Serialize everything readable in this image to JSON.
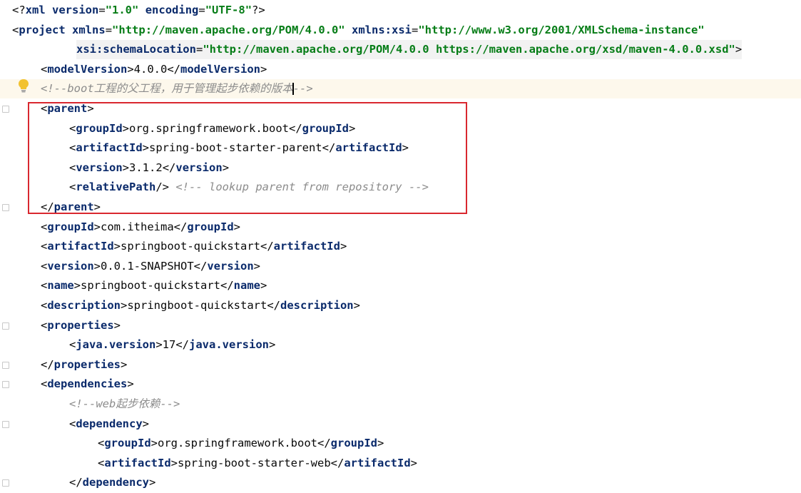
{
  "editor": {
    "lines": [
      {
        "indent": 0,
        "parts": [
          [
            "decl",
            "<?"
          ],
          [
            "tag",
            "xml"
          ],
          [
            "text",
            " "
          ],
          [
            "attr",
            "version"
          ],
          [
            "punc",
            "="
          ],
          [
            "str",
            "\"1.0\""
          ],
          [
            "text",
            " "
          ],
          [
            "attr",
            "encoding"
          ],
          [
            "punc",
            "="
          ],
          [
            "str",
            "\"UTF-8\""
          ],
          [
            "decl",
            "?>"
          ]
        ]
      },
      {
        "indent": 0,
        "parts": [
          [
            "punc",
            "<"
          ],
          [
            "tag",
            "project"
          ],
          [
            "text",
            " "
          ],
          [
            "attr",
            "xmlns"
          ],
          [
            "punc",
            "="
          ],
          [
            "str",
            "\"http://maven.apache.org/POM/4.0.0\""
          ],
          [
            "text",
            " "
          ],
          [
            "attr",
            "xmlns:xsi"
          ],
          [
            "punc",
            "="
          ],
          [
            "str",
            "\"http://www.w3.org/2001/XMLSchema-instance\""
          ]
        ]
      },
      {
        "indent": 2.25,
        "schema": true,
        "parts": [
          [
            "attr",
            "xsi:schemaLocation"
          ],
          [
            "punc",
            "="
          ],
          [
            "str",
            "\"http://maven.apache.org/POM/4.0.0 https://maven.apache.org/xsd/maven-4.0.0.xsd\""
          ],
          [
            "punc",
            ">"
          ]
        ]
      },
      {
        "indent": 1,
        "parts": [
          [
            "punc",
            "<"
          ],
          [
            "tag",
            "modelVersion"
          ],
          [
            "punc",
            ">"
          ],
          [
            "text",
            "4.0.0"
          ],
          [
            "punc",
            "</"
          ],
          [
            "tag",
            "modelVersion"
          ],
          [
            "punc",
            ">"
          ]
        ]
      },
      {
        "indent": 1,
        "hl": true,
        "parts": [
          [
            "comment",
            "<!--boot工程的父工程，用于管理起步依赖的版本"
          ],
          [
            "caret",
            ""
          ],
          [
            "comment",
            "-->"
          ]
        ]
      },
      {
        "indent": 1,
        "parts": [
          [
            "punc",
            "<"
          ],
          [
            "tag",
            "parent"
          ],
          [
            "punc",
            ">"
          ]
        ]
      },
      {
        "indent": 2,
        "parts": [
          [
            "punc",
            "<"
          ],
          [
            "tag",
            "groupId"
          ],
          [
            "punc",
            ">"
          ],
          [
            "text",
            "org.springframework.boot"
          ],
          [
            "punc",
            "</"
          ],
          [
            "tag",
            "groupId"
          ],
          [
            "punc",
            ">"
          ]
        ]
      },
      {
        "indent": 2,
        "parts": [
          [
            "punc",
            "<"
          ],
          [
            "tag",
            "artifactId"
          ],
          [
            "punc",
            ">"
          ],
          [
            "text",
            "spring-boot-starter-parent"
          ],
          [
            "punc",
            "</"
          ],
          [
            "tag",
            "artifactId"
          ],
          [
            "punc",
            ">"
          ]
        ]
      },
      {
        "indent": 2,
        "parts": [
          [
            "punc",
            "<"
          ],
          [
            "tag",
            "version"
          ],
          [
            "punc",
            ">"
          ],
          [
            "text",
            "3.1.2"
          ],
          [
            "punc",
            "</"
          ],
          [
            "tag",
            "version"
          ],
          [
            "punc",
            ">"
          ]
        ]
      },
      {
        "indent": 2,
        "parts": [
          [
            "punc",
            "<"
          ],
          [
            "tag",
            "relativePath"
          ],
          [
            "punc",
            "/>"
          ],
          [
            "text",
            " "
          ],
          [
            "comment",
            "<!-- lookup parent from repository -->"
          ]
        ]
      },
      {
        "indent": 1,
        "parts": [
          [
            "punc",
            "</"
          ],
          [
            "tag",
            "parent"
          ],
          [
            "punc",
            ">"
          ]
        ]
      },
      {
        "indent": 1,
        "parts": [
          [
            "punc",
            "<"
          ],
          [
            "tag",
            "groupId"
          ],
          [
            "punc",
            ">"
          ],
          [
            "text",
            "com.itheima"
          ],
          [
            "punc",
            "</"
          ],
          [
            "tag",
            "groupId"
          ],
          [
            "punc",
            ">"
          ]
        ]
      },
      {
        "indent": 1,
        "parts": [
          [
            "punc",
            "<"
          ],
          [
            "tag",
            "artifactId"
          ],
          [
            "punc",
            ">"
          ],
          [
            "text",
            "springboot-quickstart"
          ],
          [
            "punc",
            "</"
          ],
          [
            "tag",
            "artifactId"
          ],
          [
            "punc",
            ">"
          ]
        ]
      },
      {
        "indent": 1,
        "parts": [
          [
            "punc",
            "<"
          ],
          [
            "tag",
            "version"
          ],
          [
            "punc",
            ">"
          ],
          [
            "text",
            "0.0.1-SNAPSHOT"
          ],
          [
            "punc",
            "</"
          ],
          [
            "tag",
            "version"
          ],
          [
            "punc",
            ">"
          ]
        ]
      },
      {
        "indent": 1,
        "parts": [
          [
            "punc",
            "<"
          ],
          [
            "tag",
            "name"
          ],
          [
            "punc",
            ">"
          ],
          [
            "text",
            "springboot-quickstart"
          ],
          [
            "punc",
            "</"
          ],
          [
            "tag",
            "name"
          ],
          [
            "punc",
            ">"
          ]
        ]
      },
      {
        "indent": 1,
        "parts": [
          [
            "punc",
            "<"
          ],
          [
            "tag",
            "description"
          ],
          [
            "punc",
            ">"
          ],
          [
            "text",
            "springboot-quickstart"
          ],
          [
            "punc",
            "</"
          ],
          [
            "tag",
            "description"
          ],
          [
            "punc",
            ">"
          ]
        ]
      },
      {
        "indent": 1,
        "parts": [
          [
            "punc",
            "<"
          ],
          [
            "tag",
            "properties"
          ],
          [
            "punc",
            ">"
          ]
        ]
      },
      {
        "indent": 2,
        "parts": [
          [
            "punc",
            "<"
          ],
          [
            "tag",
            "java.version"
          ],
          [
            "punc",
            ">"
          ],
          [
            "text",
            "17"
          ],
          [
            "punc",
            "</"
          ],
          [
            "tag",
            "java.version"
          ],
          [
            "punc",
            ">"
          ]
        ]
      },
      {
        "indent": 1,
        "parts": [
          [
            "punc",
            "</"
          ],
          [
            "tag",
            "properties"
          ],
          [
            "punc",
            ">"
          ]
        ]
      },
      {
        "indent": 1,
        "parts": [
          [
            "punc",
            "<"
          ],
          [
            "tag",
            "dependencies"
          ],
          [
            "punc",
            ">"
          ]
        ]
      },
      {
        "indent": 2,
        "parts": [
          [
            "comment",
            "<!--web起步依赖-->"
          ]
        ]
      },
      {
        "indent": 2,
        "parts": [
          [
            "punc",
            "<"
          ],
          [
            "tag",
            "dependency"
          ],
          [
            "punc",
            ">"
          ]
        ]
      },
      {
        "indent": 3,
        "parts": [
          [
            "punc",
            "<"
          ],
          [
            "tag",
            "groupId"
          ],
          [
            "punc",
            ">"
          ],
          [
            "text",
            "org.springframework.boot"
          ],
          [
            "punc",
            "</"
          ],
          [
            "tag",
            "groupId"
          ],
          [
            "punc",
            ">"
          ]
        ]
      },
      {
        "indent": 3,
        "parts": [
          [
            "punc",
            "<"
          ],
          [
            "tag",
            "artifactId"
          ],
          [
            "punc",
            ">"
          ],
          [
            "text",
            "spring-boot-starter-web"
          ],
          [
            "punc",
            "</"
          ],
          [
            "tag",
            "artifactId"
          ],
          [
            "punc",
            ">"
          ]
        ]
      },
      {
        "indent": 2,
        "parts": [
          [
            "punc",
            "</"
          ],
          [
            "tag",
            "dependency"
          ],
          [
            "punc",
            ">"
          ]
        ]
      }
    ],
    "colors": {
      "tag": "#0a2a6b",
      "string": "#067d17",
      "comment": "#8c8c8c",
      "highlight_border": "#d9282f",
      "line_highlight": "#fdf8ec"
    },
    "icons": [
      "lightbulb-icon",
      "fold-marker-icon"
    ]
  }
}
